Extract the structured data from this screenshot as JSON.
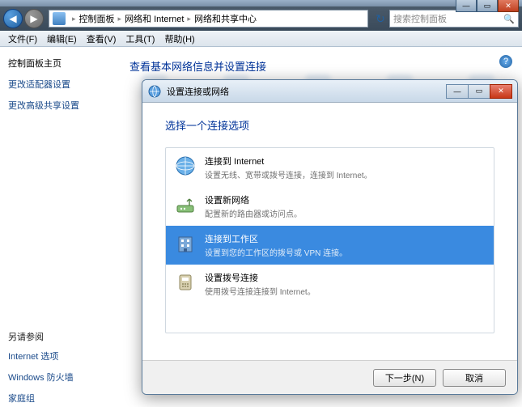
{
  "chrome": {
    "min": "—",
    "max": "▭",
    "close": "✕"
  },
  "nav": {
    "back": "◀",
    "fwd": "▶",
    "crumbs": [
      "控制面板",
      "网络和 Internet",
      "网络和共享中心"
    ],
    "refresh": "↻",
    "search_placeholder": "搜索控制面板",
    "search_icon": "🔍"
  },
  "menu": {
    "file": "文件(F)",
    "edit": "编辑(E)",
    "view": "查看(V)",
    "tools": "工具(T)",
    "help": "帮助(H)"
  },
  "sidebar": {
    "heading": "控制面板主页",
    "link1": "更改适配器设置",
    "link2": "更改高级共享设置",
    "footer_heading": "另请参阅",
    "foot1": "Internet 选项",
    "foot2": "Windows 防火墙",
    "foot3": "家庭组"
  },
  "content": {
    "heading": "查看基本网络信息并设置连接",
    "help": "?"
  },
  "modal": {
    "title": "设置连接或网络",
    "heading": "选择一个连接选项",
    "options": [
      {
        "title": "连接到 Internet",
        "sub": "设置无线、宽带或拨号连接，连接到 Internet。"
      },
      {
        "title": "设置新网络",
        "sub": "配置新的路由器或访问点。"
      },
      {
        "title": "连接到工作区",
        "sub": "设置到您的工作区的拨号或 VPN 连接。"
      },
      {
        "title": "设置拨号连接",
        "sub": "使用拨号连接连接到 Internet。"
      }
    ],
    "selected_index": 2,
    "next": "下一步(N)",
    "cancel": "取消",
    "min": "—",
    "max": "▭",
    "close": "✕"
  }
}
